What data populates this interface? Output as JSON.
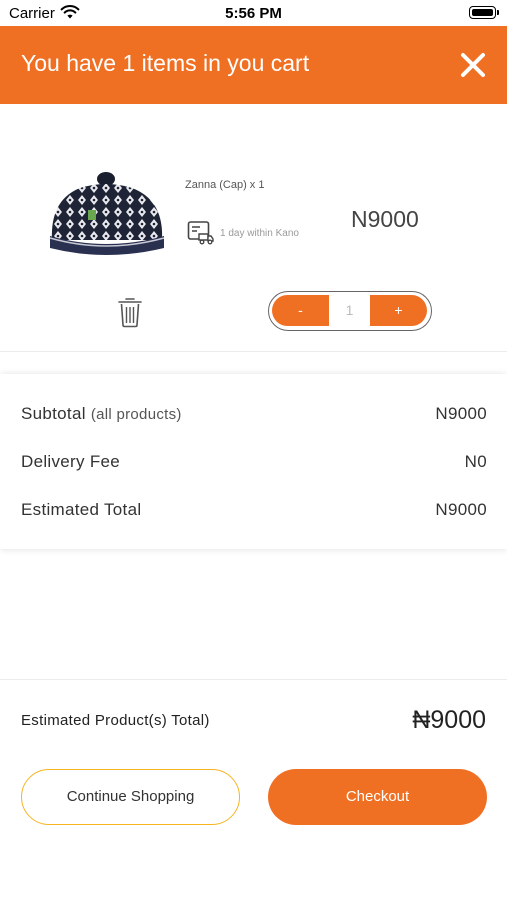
{
  "status_bar": {
    "carrier": "Carrier",
    "time": "5:56 PM"
  },
  "header": {
    "title": "You have 1 items in you cart",
    "close_icon": "close-icon"
  },
  "cart_item": {
    "name": "Zanna (Cap) x 1",
    "delivery_text": "1 day within Kano",
    "price": "N9000",
    "quantity": "1",
    "minus_label": "-",
    "plus_label": "+"
  },
  "summary": {
    "subtotal_label": "Subtotal",
    "subtotal_sub": "(all products)",
    "subtotal_value": "N9000",
    "delivery_label": "Delivery Fee",
    "delivery_value": "N0",
    "estimated_label": "Estimated Total",
    "estimated_value": "N9000"
  },
  "footer": {
    "product_total_label": "Estimated Product(s) Total)",
    "product_total_value": "₦9000",
    "continue_label": "Continue Shopping",
    "checkout_label": "Checkout"
  },
  "colors": {
    "accent": "#f07023",
    "secondary_border": "#f5b521"
  }
}
